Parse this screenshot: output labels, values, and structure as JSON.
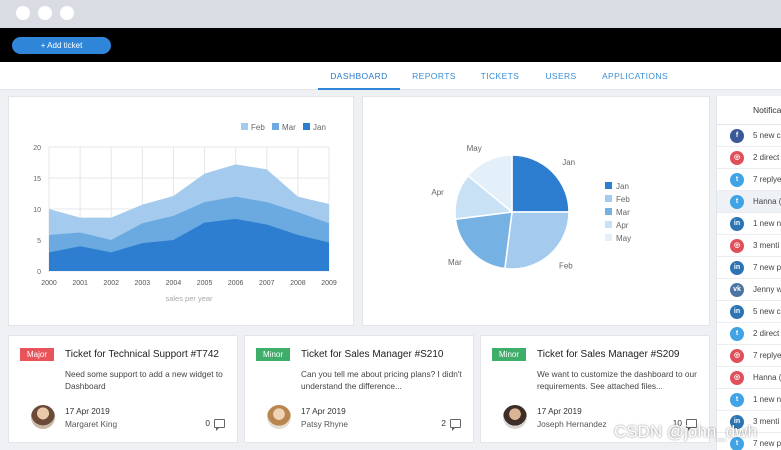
{
  "topbar": {
    "add_ticket_label": "+ Add ticket"
  },
  "nav": {
    "tabs": [
      "DASHBOARD",
      "REPORTS",
      "TICKETS",
      "USERS",
      "APPLICATIONS"
    ],
    "active": "DASHBOARD"
  },
  "chart_data": [
    {
      "type": "area",
      "x": [
        "2000",
        "2001",
        "2002",
        "2003",
        "2004",
        "2005",
        "2006",
        "2007",
        "2008",
        "2009"
      ],
      "series": [
        {
          "name": "Jan",
          "values": [
            3,
            4,
            3,
            4.5,
            5,
            7.8,
            8.4,
            7.5,
            5.8,
            4.6
          ]
        },
        {
          "name": "Mar",
          "values": [
            2.8,
            2.2,
            2,
            3.2,
            3.9,
            3.3,
            3.6,
            3.6,
            3.7,
            3.1
          ]
        },
        {
          "name": "Feb",
          "values": [
            4.2,
            2.4,
            3.6,
            3,
            3.2,
            4.6,
            5.2,
            5.3,
            2.5,
            3.1
          ]
        }
      ],
      "legend": [
        "Feb",
        "Mar",
        "Jan"
      ],
      "yticks": [
        "0",
        "5",
        "10",
        "15",
        "20"
      ],
      "xlabel": "sales per year",
      "ylim": [
        0,
        20
      ],
      "grid": true,
      "legend_position": "top-right",
      "colors": {
        "Jan": "#2d7ed0",
        "Mar": "#6aaae0",
        "Feb": "#a4cbee"
      }
    },
    {
      "type": "pie",
      "labels": [
        "Jan",
        "Feb",
        "Mar",
        "Apr",
        "May"
      ],
      "values": [
        25,
        27,
        21,
        13,
        14
      ],
      "legend_position": "right",
      "colors": [
        "#2d7ed0",
        "#a4cbee",
        "#76b1e3",
        "#c9e1f5",
        "#e3eff9"
      ]
    }
  ],
  "tickets": [
    {
      "badge": "Major",
      "badge_color": "#e8545a",
      "title": "Ticket for Technical Support #T742",
      "desc": "Need some support to add a new widget to Dashboard",
      "date": "17 Apr 2019",
      "author": "Margaret King",
      "comments": "0"
    },
    {
      "badge": "Minor",
      "badge_color": "#3fae6a",
      "title": "Ticket for Sales Manager #S210",
      "desc": "Can you tell me about pricing plans? I didn't understand the difference...",
      "date": "17 Apr 2019",
      "author": "Patsy Rhyne",
      "comments": "2"
    },
    {
      "badge": "Minor",
      "badge_color": "#3fae6a",
      "title": "Ticket for Sales Manager #S209",
      "desc": "We want to customize the dashboard to our requirements. See attached files...",
      "date": "17 Apr 2019",
      "author": "Joseph Hernandez",
      "comments": "10"
    }
  ],
  "notifications": {
    "title": "Notifica",
    "items": [
      {
        "icon": "facebook-icon",
        "glyph": "f",
        "color": "#3b5998",
        "text": "5 new c"
      },
      {
        "icon": "instagram-icon",
        "glyph": "◎",
        "color": "#e0505a",
        "text": "2 direct"
      },
      {
        "icon": "twitter-icon",
        "glyph": "t",
        "color": "#40a3e6",
        "text": "7 replye"
      },
      {
        "icon": "twitter-icon",
        "glyph": "t",
        "color": "#40a3e6",
        "text": "Hanna ("
      },
      {
        "icon": "linkedin-icon",
        "glyph": "in",
        "color": "#2c74b3",
        "text": "1 new n"
      },
      {
        "icon": "instagram-icon",
        "glyph": "◎",
        "color": "#e0505a",
        "text": "3 menti"
      },
      {
        "icon": "linkedin-icon",
        "glyph": "in",
        "color": "#2c74b3",
        "text": "7 new p"
      },
      {
        "icon": "vk-icon",
        "glyph": "vk",
        "color": "#4c75a3",
        "text": "Jenny w"
      },
      {
        "icon": "linkedin-icon",
        "glyph": "in",
        "color": "#2c74b3",
        "text": "5 new c"
      },
      {
        "icon": "twitter-icon",
        "glyph": "t",
        "color": "#40a3e6",
        "text": "2 direct"
      },
      {
        "icon": "instagram-icon",
        "glyph": "◎",
        "color": "#e0505a",
        "text": "7 replye"
      },
      {
        "icon": "instagram-icon",
        "glyph": "◎",
        "color": "#e0505a",
        "text": "Hanna ("
      },
      {
        "icon": "twitter-icon",
        "glyph": "t",
        "color": "#40a3e6",
        "text": "1 new n"
      },
      {
        "icon": "linkedin-icon",
        "glyph": "in",
        "color": "#2c74b3",
        "text": "3 menti"
      },
      {
        "icon": "twitter-icon",
        "glyph": "t",
        "color": "#40a3e6",
        "text": "7 new p"
      }
    ]
  },
  "watermark": "CSDN @john_dwh"
}
